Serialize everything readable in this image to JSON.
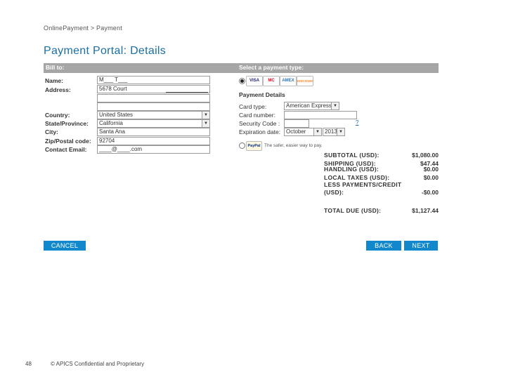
{
  "breadcrumb": "OnlinePayment > Payment",
  "page_title": "Payment Portal: Details",
  "header": {
    "bill_to": "Bill to:",
    "select_payment": "Select a payment type:"
  },
  "bill_to": {
    "name_label": "Name:",
    "name_value": "M___ T___",
    "address_label": "Address:",
    "address_value": "5678 Court",
    "country_label": "Country:",
    "country_value": "United States",
    "state_label": "State/Province:",
    "state_value": "California",
    "city_label": "City:",
    "city_value": "Santa Ana",
    "zip_label": "Zip/Postal code:",
    "zip_value": "92704",
    "email_label": "Contact Email:",
    "email_value": "____@____.com"
  },
  "payment": {
    "cards": [
      {
        "name": "VISA",
        "color": "#1a1f71"
      },
      {
        "name": "MC",
        "color": "#eb001b"
      },
      {
        "name": "AMEX",
        "color": "#2e77bc"
      },
      {
        "name": "DISCOVER",
        "color": "#f58220"
      }
    ],
    "details_title": "Payment Details",
    "card_type_label": "Card type:",
    "card_type_value": "American Express",
    "card_number_label": "Card number:",
    "security_code_label": "Security Code :",
    "help_link": "?",
    "expiration_label": "Expiration date:",
    "exp_month": "October",
    "exp_year": "2013",
    "paypal_label": "PayPal",
    "paypal_text": "The safer, easier way to pay."
  },
  "totals": [
    {
      "label": "SUBTOTAL (USD):",
      "value": "$1,080.00"
    },
    {
      "label": "SHIPPING (USD):",
      "value": "$47.44"
    },
    {
      "label": "HANDLING (USD):",
      "value": "$0.00"
    },
    {
      "label": "LOCAL TAXES (USD):",
      "value": "$0.00"
    },
    {
      "label": "LESS PAYMENTS/CREDIT",
      "value": ""
    },
    {
      "label": "(USD):",
      "value": "-$0.00"
    },
    {
      "label": "TOTAL DUE (USD):",
      "value": "$1,127.44"
    }
  ],
  "buttons": {
    "cancel": "CANCEL",
    "back": "BACK",
    "next": "NEXT"
  },
  "footer": {
    "page_number": "48",
    "copyright": "© APICS Confidential and Proprietary"
  },
  "colors": {
    "title": "#1a6fa5",
    "header_bar": "#a6a6a6",
    "button": "#1188cc"
  }
}
